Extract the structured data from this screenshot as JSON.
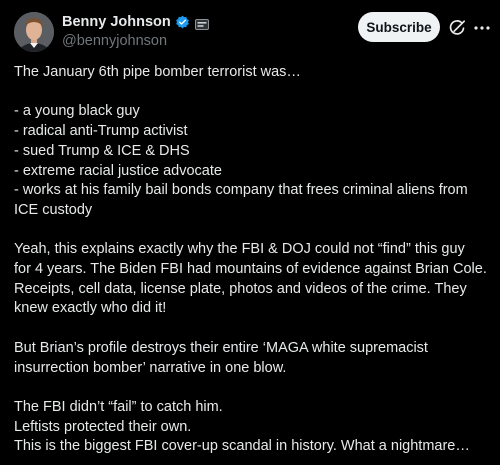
{
  "author": {
    "display_name": "Benny Johnson",
    "handle": "@bennyjohnson"
  },
  "header": {
    "subscribe_label": "Subscribe",
    "verified_color": "#1d9bf0"
  },
  "post": {
    "lines": [
      "The January 6th pipe bomber terrorist was…",
      "",
      "- a young black guy",
      "- radical anti-Trump activist",
      "- sued Trump & ICE & DHS",
      "- extreme racial justice advocate",
      "- works at his family bail bonds company that frees criminal aliens from",
      "ICE custody",
      "",
      "Yeah, this explains exactly why the FBI & DOJ could not “find” this guy",
      "for 4 years. The Biden FBI had mountains of evidence against Brian Cole.",
      "Receipts, cell data, license plate, photos and videos of the crime. They",
      "knew exactly who did it!",
      "",
      "But Brian’s profile destroys their entire ‘MAGA white supremacist",
      "insurrection bomber’ narrative in one blow.",
      "",
      "The FBI didn’t “fail” to catch him.",
      "Leftists protected their own.",
      "This is the biggest FBI cover-up scandal in history. What a nightmare…"
    ]
  }
}
